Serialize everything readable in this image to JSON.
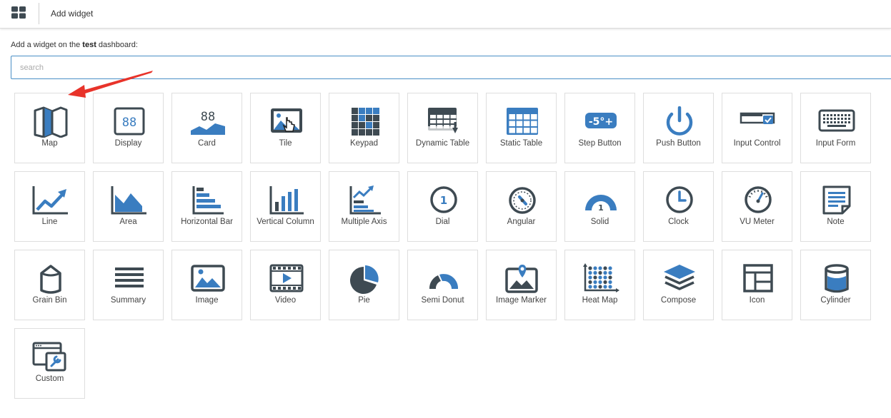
{
  "topbar": {
    "title": "Add widget",
    "apps_icon": "grid-apps-icon"
  },
  "header": {
    "prefix": "Add a widget on the ",
    "dashboard": "test",
    "suffix": " dashboard:"
  },
  "search": {
    "placeholder": "search",
    "value": ""
  },
  "colors": {
    "accent": "#3a7dc0",
    "icon_dark": "#3e4a52",
    "border": "#dedede",
    "arrow": "#e8332a"
  },
  "widgets": [
    {
      "label": "Map",
      "icon": "map-icon"
    },
    {
      "label": "Display",
      "icon": "display-icon"
    },
    {
      "label": "Card",
      "icon": "card-icon"
    },
    {
      "label": "Tile",
      "icon": "tile-icon"
    },
    {
      "label": "Keypad",
      "icon": "keypad-icon"
    },
    {
      "label": "Dynamic Table",
      "icon": "dynamic-table-icon"
    },
    {
      "label": "Static Table",
      "icon": "static-table-icon"
    },
    {
      "label": "Step Button",
      "icon": "step-button-icon",
      "icon_text": "-5°+"
    },
    {
      "label": "Push Button",
      "icon": "push-button-icon"
    },
    {
      "label": "Input Control",
      "icon": "input-control-icon"
    },
    {
      "label": "Input Form",
      "icon": "input-form-icon"
    },
    {
      "label": "Line",
      "icon": "line-chart-icon"
    },
    {
      "label": "Area",
      "icon": "area-chart-icon"
    },
    {
      "label": "Horizontal Bar",
      "icon": "horizontal-bar-icon"
    },
    {
      "label": "Vertical Column",
      "icon": "vertical-column-icon"
    },
    {
      "label": "Multiple Axis",
      "icon": "multiple-axis-icon"
    },
    {
      "label": "Dial",
      "icon": "dial-icon",
      "icon_text": "1"
    },
    {
      "label": "Angular",
      "icon": "angular-gauge-icon"
    },
    {
      "label": "Solid",
      "icon": "solid-gauge-icon",
      "icon_text": "1"
    },
    {
      "label": "Clock",
      "icon": "clock-icon"
    },
    {
      "label": "VU Meter",
      "icon": "vu-meter-icon"
    },
    {
      "label": "Note",
      "icon": "note-icon"
    },
    {
      "label": "Grain Bin",
      "icon": "grain-bin-icon"
    },
    {
      "label": "Summary",
      "icon": "summary-icon"
    },
    {
      "label": "Image",
      "icon": "image-icon"
    },
    {
      "label": "Video",
      "icon": "video-icon"
    },
    {
      "label": "Pie",
      "icon": "pie-icon"
    },
    {
      "label": "Semi Donut",
      "icon": "semi-donut-icon"
    },
    {
      "label": "Image Marker",
      "icon": "image-marker-icon"
    },
    {
      "label": "Heat Map",
      "icon": "heat-map-icon"
    },
    {
      "label": "Compose",
      "icon": "compose-icon"
    },
    {
      "label": "Icon",
      "icon": "icon-layout-icon"
    },
    {
      "label": "Cylinder",
      "icon": "cylinder-icon"
    },
    {
      "label": "Custom",
      "icon": "custom-icon"
    }
  ]
}
